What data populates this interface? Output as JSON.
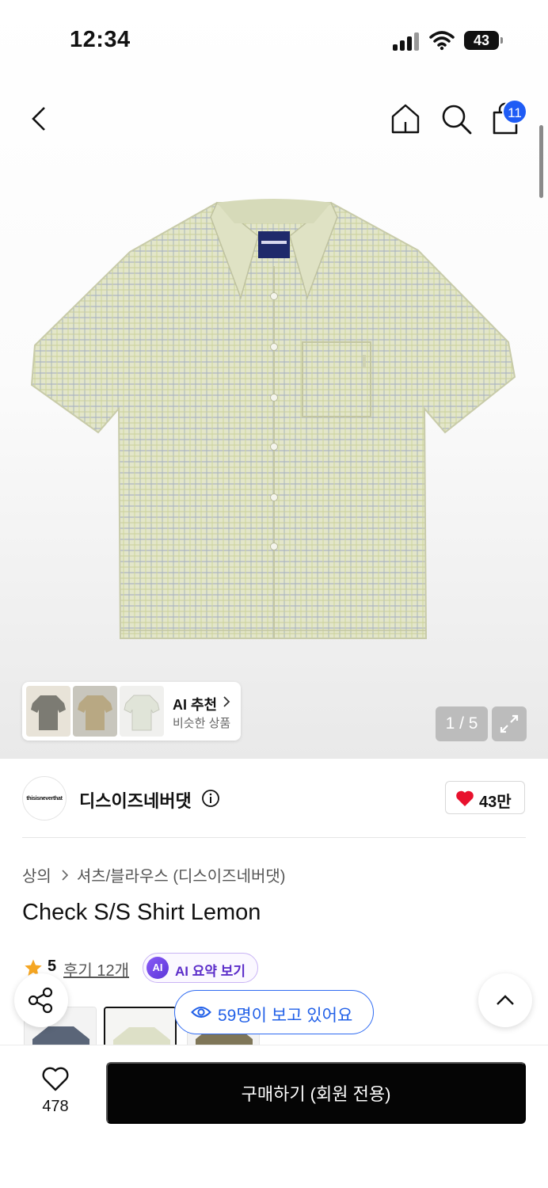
{
  "status_bar": {
    "time": "12:34",
    "battery": "43"
  },
  "header": {
    "cart_count": "11"
  },
  "gallery": {
    "counter": "1 / 5",
    "ai_recommend": {
      "title": "AI 추천",
      "subtitle": "비슷한 상품"
    }
  },
  "brand": {
    "name": "디스이즈네버댓",
    "logo_text": "thisisneverthat",
    "likes": "43만"
  },
  "breadcrumb": {
    "category": "상의",
    "subcategory": "셔츠/블라우스 (디스이즈네버댓)"
  },
  "product": {
    "title": "Check S/S Shirt Lemon"
  },
  "rating": {
    "score": "5",
    "reviews": "후기 12개",
    "ai_summary_label": "AI 요약 보기",
    "ai_badge": "AI"
  },
  "viewers": {
    "text": "59명이 보고 있어요"
  },
  "bottom": {
    "wish_count": "478",
    "buy_label": "구매하기 (회원 전용)"
  },
  "colors": {
    "accent_blue": "#1f5cf5",
    "heart_red": "#e8112d",
    "star_orange": "#f5a623",
    "ai_purple": "#6a3de8"
  }
}
